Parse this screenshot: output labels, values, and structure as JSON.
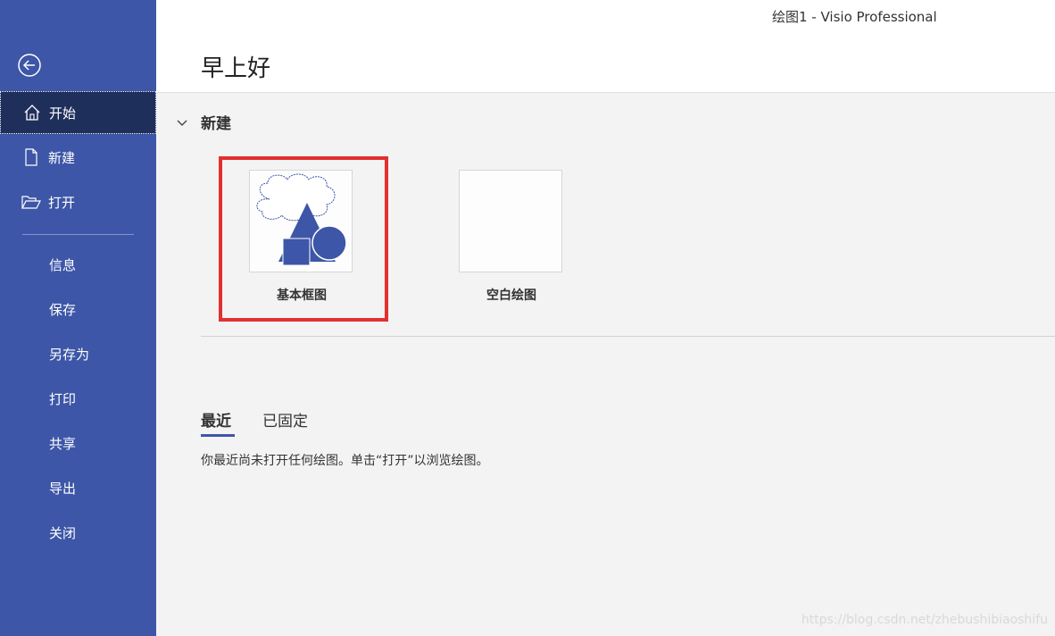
{
  "window": {
    "title": "绘图1  -  Visio Professional"
  },
  "sidebar": {
    "items": [
      {
        "label": "开始",
        "icon": "home-icon"
      },
      {
        "label": "新建",
        "icon": "new-document-icon"
      },
      {
        "label": "打开",
        "icon": "open-folder-icon"
      },
      {
        "label": "信息"
      },
      {
        "label": "保存"
      },
      {
        "label": "另存为"
      },
      {
        "label": "打印"
      },
      {
        "label": "共享"
      },
      {
        "label": "导出"
      },
      {
        "label": "关闭"
      }
    ],
    "active_index": 0
  },
  "main": {
    "greeting": "早上好",
    "new_section": {
      "title": "新建",
      "templates": [
        {
          "label": "基本框图",
          "thumbnail": "basic-diagram-shapes"
        },
        {
          "label": "空白绘图",
          "thumbnail": "blank"
        }
      ]
    },
    "recent": {
      "tabs": [
        {
          "label": "最近"
        },
        {
          "label": "已固定"
        }
      ],
      "active_tab": 0,
      "empty_message": "你最近尚未打开任何绘图。单击“打开”以浏览绘图。"
    }
  },
  "watermark": "https://blog.csdn.net/zhebushibiaoshifu",
  "colors": {
    "sidebar": "#3d56a7",
    "sidebar_active": "#1f2f5c",
    "highlight": "#e23030",
    "shape_fill": "#3d56a7"
  }
}
